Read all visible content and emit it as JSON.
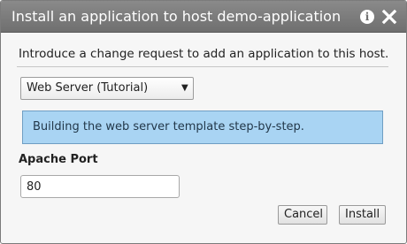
{
  "dialog": {
    "title": "Install an application to host demo-application",
    "info_icon": "i",
    "close_icon": "close-icon"
  },
  "intro_text": "Introduce a change request to add an application to this host.",
  "application_select": {
    "selected": "Web Server (Tutorial)",
    "chevron": "▼"
  },
  "info_banner": {
    "text": "Building the web server template step-by-step.",
    "background_color": "#a9d4f3"
  },
  "apache_port": {
    "label": "Apache Port",
    "value": "80"
  },
  "buttons": {
    "cancel_label": "Cancel",
    "install_label": "Install"
  }
}
